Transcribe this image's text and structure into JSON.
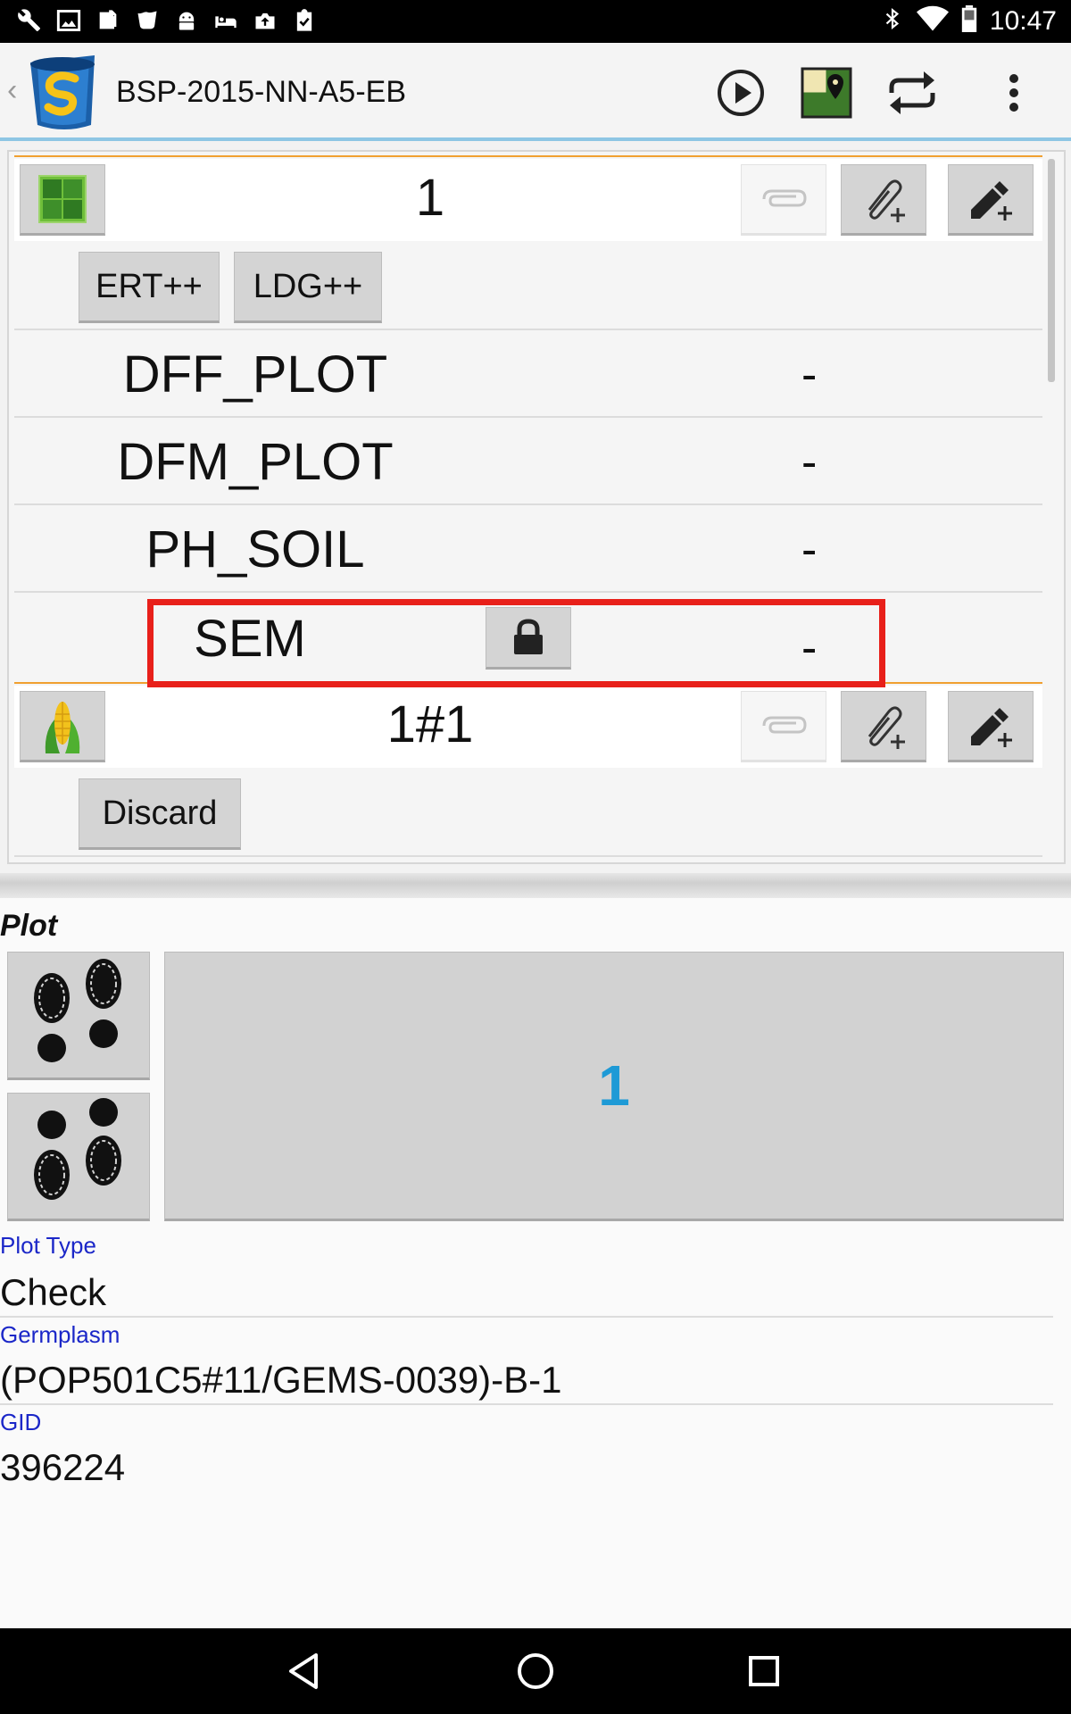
{
  "status_bar": {
    "time": "10:47",
    "icons": [
      "wrench-icon",
      "image-icon",
      "files-icon",
      "cup-icon",
      "android-icon",
      "bed-icon",
      "upload-icon",
      "clipboard-check-icon",
      "bluetooth-icon",
      "wifi-icon",
      "battery-icon"
    ]
  },
  "action_bar": {
    "title": "BSP-2015-NN-A5-EB",
    "back_glyph": "‹",
    "actions": [
      "play-icon",
      "map-icon",
      "sync-icon",
      "overflow-menu-icon"
    ]
  },
  "list": {
    "plot_row": {
      "label": "1",
      "buttons": [
        "ERT++",
        "LDG++"
      ]
    },
    "traits": [
      {
        "name": "DFF_PLOT",
        "value": "-"
      },
      {
        "name": "DFM_PLOT",
        "value": "-"
      },
      {
        "name": "PH_SOIL",
        "value": "-"
      },
      {
        "name": "SEM",
        "value": "-",
        "locked": true
      }
    ],
    "sub_row": {
      "label": "1#1",
      "buttons": [
        "Discard"
      ]
    }
  },
  "plot_panel": {
    "heading": "Plot",
    "plot_number": "1",
    "fields": [
      {
        "label": "Plot Type",
        "value": "Check"
      },
      {
        "label": "Germplasm",
        "value": "(POP501C5#11/GEMS-0039)-B-1"
      },
      {
        "label": "GID",
        "value": "396224"
      }
    ]
  },
  "colors": {
    "accent_blue": "#1e9ad6",
    "label_blue": "#1b27c8",
    "highlight_red": "#e8201a",
    "row_divider_orange": "#f0a030"
  }
}
